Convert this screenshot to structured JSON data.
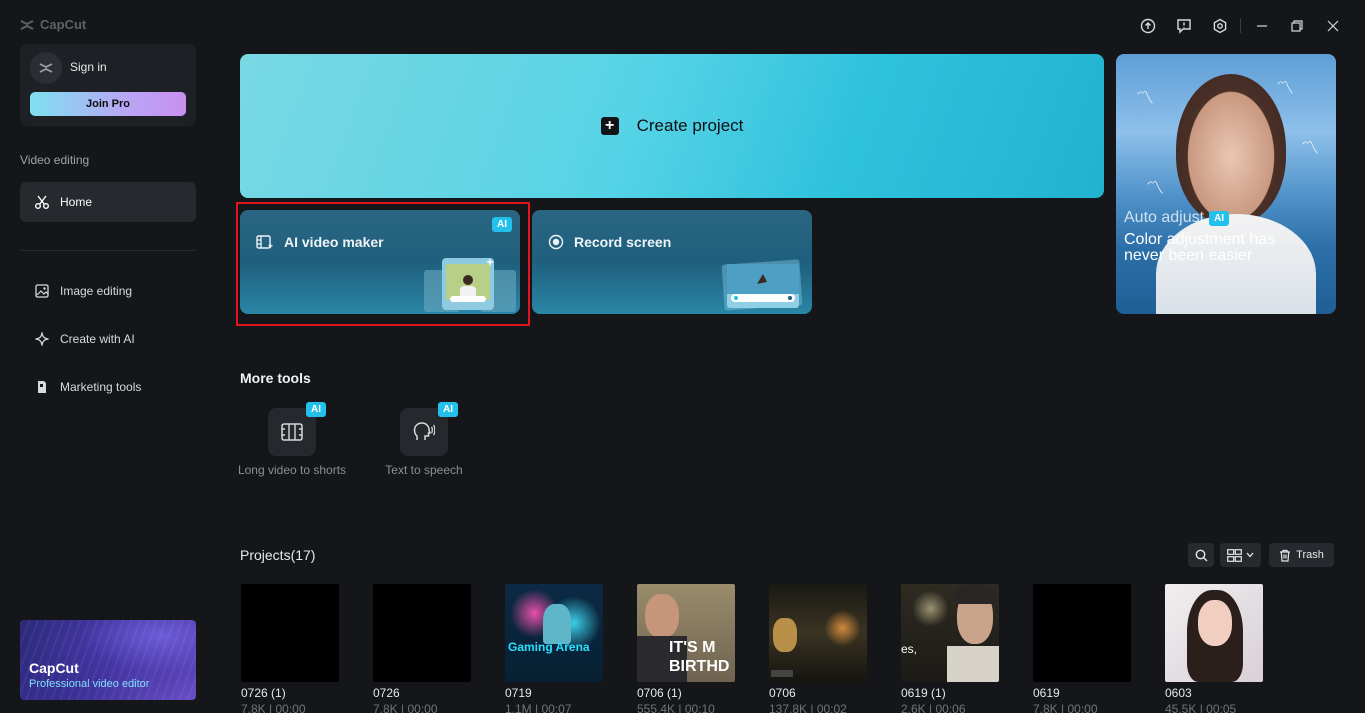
{
  "app": {
    "logo_text": "CapCut"
  },
  "sidebar": {
    "signin_label": "Sign in",
    "join_pro_label": "Join Pro",
    "section_label": "Video editing",
    "items": [
      {
        "label": "Home",
        "icon": "scissors-icon",
        "active": true
      },
      {
        "label": "Image editing",
        "icon": "image-icon"
      },
      {
        "label": "Create with AI",
        "icon": "sparkle-icon"
      },
      {
        "label": "Marketing tools",
        "icon": "marketing-icon"
      }
    ],
    "promo": {
      "title": "CapCut",
      "subtitle": "Professional video editor"
    }
  },
  "main": {
    "create_project_label": "Create project",
    "tools": [
      {
        "label": "AI video maker",
        "badge": "AI"
      },
      {
        "label": "Record screen"
      }
    ],
    "hero": {
      "subtitle": "Auto adjust",
      "badge": "AI",
      "title": "Color adjustment has never been easier"
    },
    "more_tools_title": "More tools",
    "more_tools": [
      {
        "label": "Long video to shorts",
        "badge": "AI"
      },
      {
        "label": "Text to speech",
        "badge": "AI"
      }
    ],
    "projects_title": "Projects(17)",
    "trash_label": "Trash",
    "projects": [
      {
        "name": "0726 (1)",
        "meta": "7.8K | 00:00"
      },
      {
        "name": "0726",
        "meta": "7.8K | 00:00"
      },
      {
        "name": "0719",
        "meta": "1.1M | 00:07",
        "caption": "Gaming Arena"
      },
      {
        "name": "0706 (1)",
        "meta": "555.4K | 00:10",
        "caption": "IT'S M BIRTHD"
      },
      {
        "name": "0706",
        "meta": "137.8K | 00:02"
      },
      {
        "name": "0619 (1)",
        "meta": "2.6K | 00:06",
        "caption": "es,"
      },
      {
        "name": "0619",
        "meta": "7.8K | 00:00"
      },
      {
        "name": "0603",
        "meta": "45.5K | 00:05"
      }
    ]
  },
  "colors": {
    "accent_cyan": "#23c0ec",
    "highlight_red": "#e1151b"
  }
}
